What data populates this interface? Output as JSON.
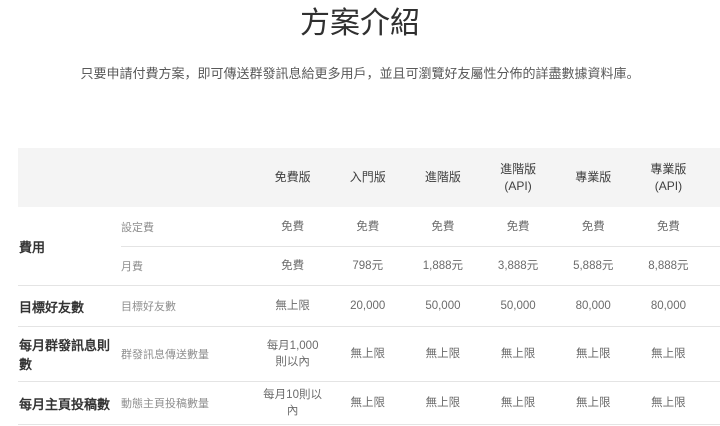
{
  "page": {
    "title": "方案介紹",
    "subtitle": "只要申請付費方案，即可傳送群發訊息給更多用戶，並且可瀏覽好友屬性分佈的詳盡數據資料庫。"
  },
  "table": {
    "columns": [
      "免費版",
      "入門版",
      "進階版",
      "進階版\n(API)",
      "專業版",
      "專業版\n(API)"
    ],
    "rows": [
      {
        "category": "費用",
        "subrows": [
          {
            "label": "設定費",
            "values": [
              "免費",
              "免費",
              "免費",
              "免費",
              "免費",
              "免費"
            ]
          },
          {
            "label": "月費",
            "values": [
              "免費",
              "798元",
              "1,888元",
              "3,888元",
              "5,888元",
              "8,888元"
            ]
          }
        ]
      },
      {
        "category": "目標好友數",
        "subrows": [
          {
            "label": "目標好友數",
            "values": [
              "無上限",
              "20,000",
              "50,000",
              "50,000",
              "80,000",
              "80,000"
            ]
          }
        ]
      },
      {
        "category": "每月群發訊息則數",
        "subrows": [
          {
            "label": "群發訊息傳送數量",
            "values": [
              "每月1,000\n則以內",
              "無上限",
              "無上限",
              "無上限",
              "無上限",
              "無上限"
            ]
          }
        ]
      },
      {
        "category": "每月主頁投稿數",
        "subrows": [
          {
            "label": "動態主頁投稿數量",
            "values": [
              "每月10則以\n內",
              "無上限",
              "無上限",
              "無上限",
              "無上限",
              "無上限"
            ]
          }
        ]
      }
    ]
  }
}
